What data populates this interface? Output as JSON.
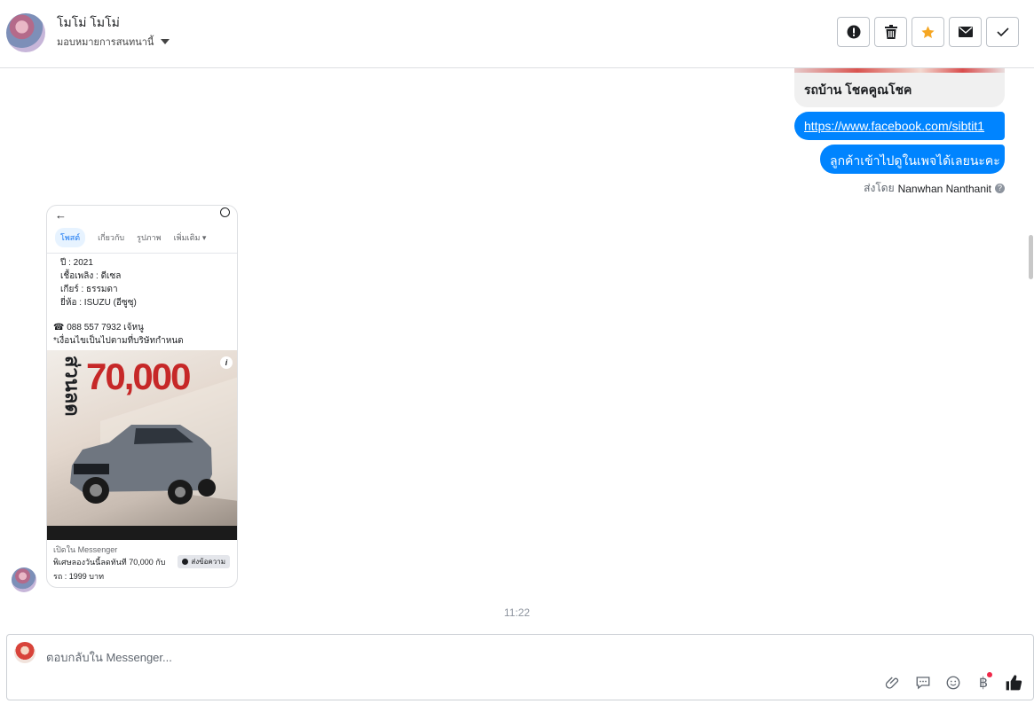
{
  "header": {
    "name": "โมโม่ โมโม่",
    "assign_label": "มอบหมายการสนทนานี้",
    "actions": [
      "spam-icon",
      "trash-icon",
      "star-icon",
      "mail-icon",
      "check-icon"
    ]
  },
  "thread": {
    "link_card_title": "รถบ้าน โชคคูณโชค",
    "url_message": "https://www.facebook.com/sibtit1",
    "text_message": "ลูกค้าเข้าไปดูในเพจได้เลยนะคะ",
    "sent_by_prefix": "ส่งโดย",
    "sent_by_name": "Nanwhan Nanthanit",
    "time": "11:22"
  },
  "shared_post": {
    "tabs": [
      "โพสต์",
      "เกี่ยวกับ",
      "รูปภาพ",
      "เพิ่มเติม"
    ],
    "lines": [
      "ปี : 2021",
      "เชื้อเพลิง : ดีเซล",
      "เกียร์ : ธรรมดา",
      "ยี่ห้อ : ISUZU (อีซูซุ)"
    ],
    "phone_line": "☎ 088 557 7932 เจ้หนู",
    "condition_line": "*เงื่อนไขเป็นไปตามที่บริษัทกำหนด",
    "ad_vertical_text": "ส่วนลด",
    "ad_big_number": "70,000",
    "open_in": "เปิดใน Messenger",
    "caption_line1": "พิเศษลองวันนี้ลดทันที 70,000 กับ",
    "caption_line2": "รถ : 1999 บาท",
    "send_button": "ส่งข้อความ"
  },
  "composer": {
    "placeholder": "ตอบกลับใน Messenger..."
  },
  "colors": {
    "accent": "#0084ff",
    "star": "#f5a623"
  }
}
